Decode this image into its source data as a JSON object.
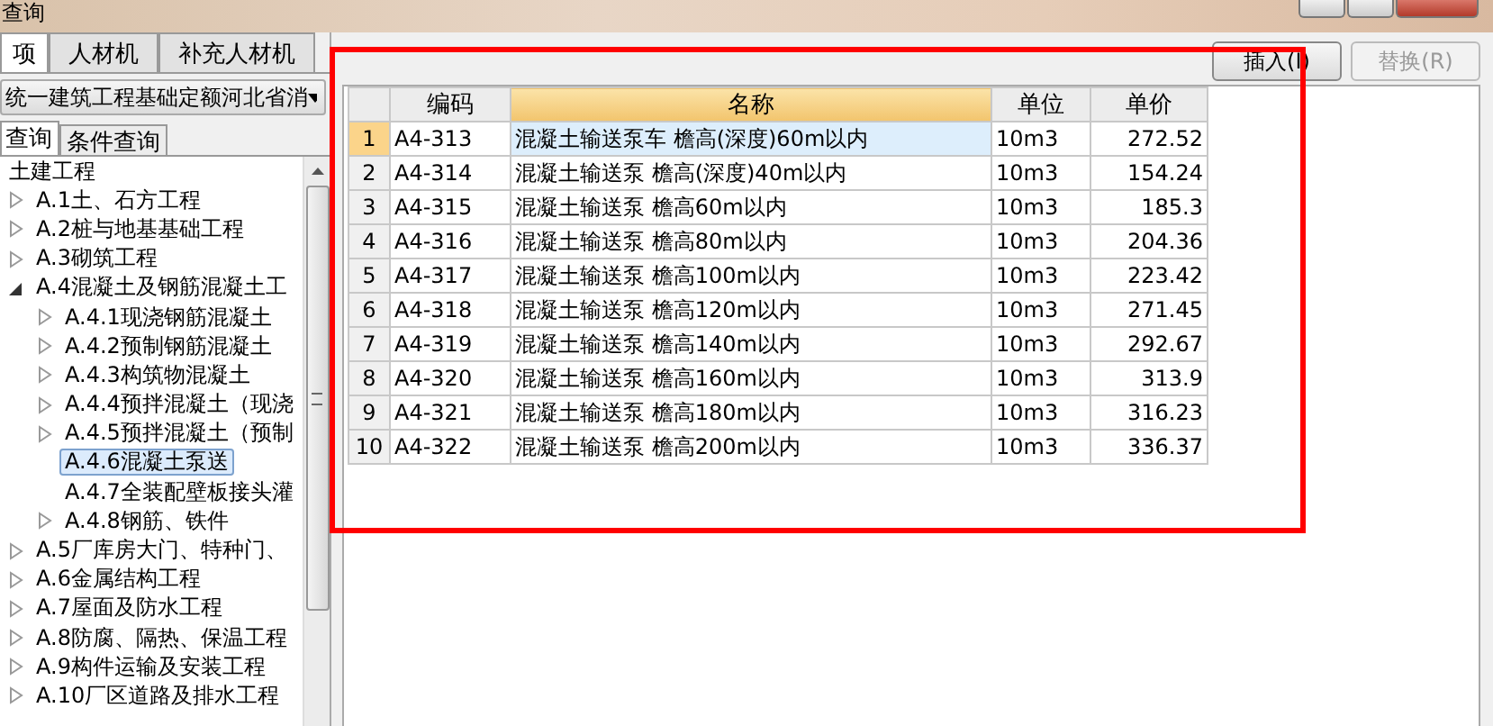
{
  "window": {
    "title": "查询"
  },
  "tabs": [
    {
      "label": "项",
      "selected": true
    },
    {
      "label": "人材机",
      "selected": false
    },
    {
      "label": "补充人材机",
      "selected": false
    }
  ],
  "quota_dropdown": {
    "value": "统一建筑工程基础定额河北省消"
  },
  "query_tabs": [
    {
      "label": "查询",
      "selected": true
    },
    {
      "label": "条件查询",
      "selected": false
    }
  ],
  "tree": [
    {
      "label": "土建工程",
      "expanded": true,
      "selected": false,
      "children": [
        {
          "label": "A.1土、石方工程",
          "expanded": false,
          "selected": false
        },
        {
          "label": "A.2桩与地基基础工程",
          "expanded": false,
          "selected": false
        },
        {
          "label": "A.3砌筑工程",
          "expanded": false,
          "selected": false
        },
        {
          "label": "A.4混凝土及钢筋混凝土工",
          "expanded": true,
          "selected": false,
          "children": [
            {
              "label": "A.4.1现浇钢筋混凝土",
              "expanded": false,
              "selected": false
            },
            {
              "label": "A.4.2预制钢筋混凝土",
              "expanded": false,
              "selected": false
            },
            {
              "label": "A.4.3构筑物混凝土",
              "expanded": false,
              "selected": false
            },
            {
              "label": "A.4.4预拌混凝土（现浇",
              "expanded": false,
              "selected": false
            },
            {
              "label": "A.4.5预拌混凝土（预制",
              "expanded": false,
              "selected": false
            },
            {
              "label": "A.4.6混凝土泵送",
              "selected": true
            },
            {
              "label": "A.4.7全装配壁板接头灌",
              "selected": false
            },
            {
              "label": "A.4.8钢筋、铁件",
              "expanded": false,
              "selected": false
            }
          ]
        },
        {
          "label": "A.5厂库房大门、特种门、",
          "expanded": false,
          "selected": false
        },
        {
          "label": "A.6金属结构工程",
          "expanded": false,
          "selected": false
        },
        {
          "label": "A.7屋面及防水工程",
          "expanded": false,
          "selected": false
        },
        {
          "label": "A.8防腐、隔热、保温工程",
          "expanded": false,
          "selected": false
        },
        {
          "label": "A.9构件运输及安装工程",
          "expanded": false,
          "selected": false
        },
        {
          "label": "A.10厂区道路及排水工程",
          "expanded": false,
          "selected": false
        }
      ]
    }
  ],
  "buttons": [
    {
      "label": "插入(I)",
      "disabled": false
    },
    {
      "label": "替换(R)",
      "disabled": true
    }
  ],
  "table": {
    "columns": [
      {
        "label": "编码",
        "selected": false
      },
      {
        "label": "名称",
        "selected": true
      },
      {
        "label": "单位",
        "selected": false
      },
      {
        "label": "单价",
        "selected": false
      }
    ],
    "rows": [
      {
        "index": "1",
        "code": "A4-313",
        "name": "混凝土输送泵车 檐高(深度)60m以内",
        "unit": "10m3",
        "price": "272.52",
        "selected": true
      },
      {
        "index": "2",
        "code": "A4-314",
        "name": "混凝土输送泵 檐高(深度)40m以内",
        "unit": "10m3",
        "price": "154.24",
        "selected": false
      },
      {
        "index": "3",
        "code": "A4-315",
        "name": "混凝土输送泵 檐高60m以内",
        "unit": "10m3",
        "price": "185.3",
        "selected": false
      },
      {
        "index": "4",
        "code": "A4-316",
        "name": "混凝土输送泵 檐高80m以内",
        "unit": "10m3",
        "price": "204.36",
        "selected": false
      },
      {
        "index": "5",
        "code": "A4-317",
        "name": "混凝土输送泵 檐高100m以内",
        "unit": "10m3",
        "price": "223.42",
        "selected": false
      },
      {
        "index": "6",
        "code": "A4-318",
        "name": "混凝土输送泵 檐高120m以内",
        "unit": "10m3",
        "price": "271.45",
        "selected": false
      },
      {
        "index": "7",
        "code": "A4-319",
        "name": "混凝土输送泵 檐高140m以内",
        "unit": "10m3",
        "price": "292.67",
        "selected": false
      },
      {
        "index": "8",
        "code": "A4-320",
        "name": "混凝土输送泵 檐高160m以内",
        "unit": "10m3",
        "price": "313.9",
        "selected": false
      },
      {
        "index": "9",
        "code": "A4-321",
        "name": "混凝土输送泵 檐高180m以内",
        "unit": "10m3",
        "price": "316.23",
        "selected": false
      },
      {
        "index": "10",
        "code": "A4-322",
        "name": "混凝土输送泵 檐高200m以内",
        "unit": "10m3",
        "price": "336.37",
        "selected": false
      }
    ]
  }
}
